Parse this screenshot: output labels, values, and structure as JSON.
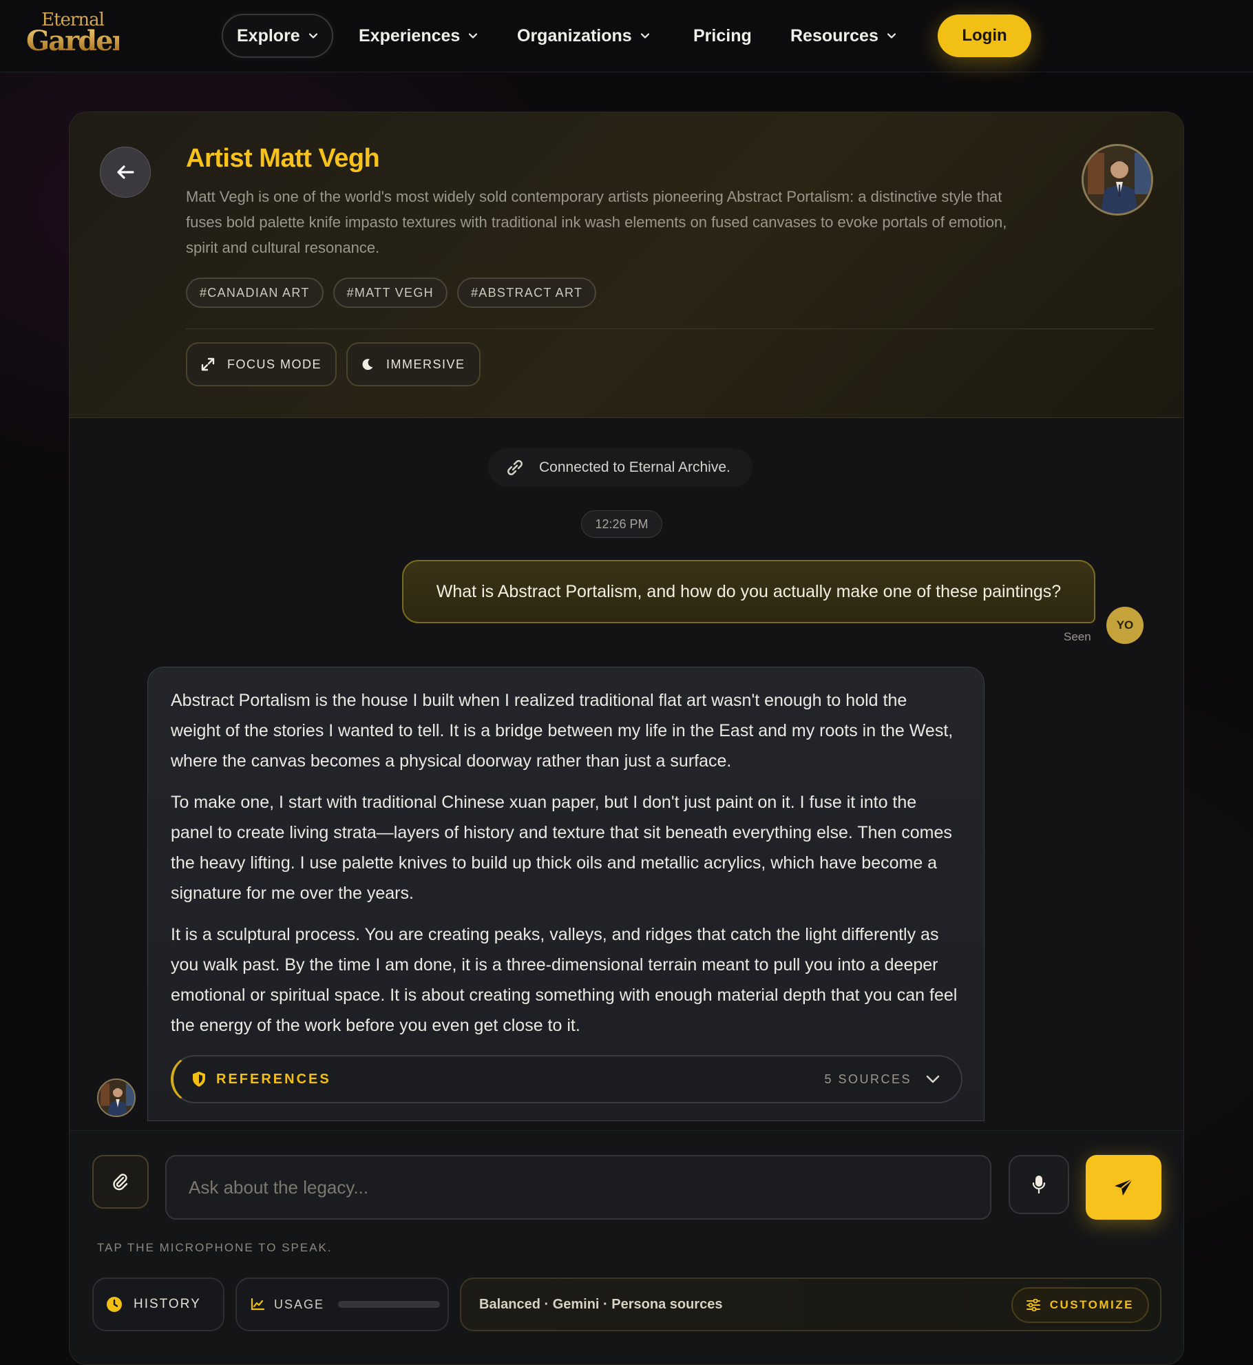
{
  "nav": {
    "logo_line1": "Eternal",
    "logo_line2": "Gardens",
    "items": [
      {
        "label": "Explore"
      },
      {
        "label": "Experiences"
      },
      {
        "label": "Organizations"
      },
      {
        "label": "Pricing"
      },
      {
        "label": "Resources"
      }
    ],
    "login_label": "Login"
  },
  "persona": {
    "title": "Artist Matt Vegh",
    "description": "Matt Vegh is one of the world's most widely sold contemporary artists pioneering Abstract Portalism: a distinctive style that fuses bold palette knife impasto textures with traditional ink wash elements on fused canvases to evoke portals of emotion, spirit and cultural resonance.",
    "tags": [
      "#CANADIAN ART",
      "#MATT VEGH",
      "#ABSTRACT ART"
    ],
    "focus_mode_label": "FOCUS MODE",
    "immersive_label": "IMMERSIVE"
  },
  "chat": {
    "connection_status": "Connected to Eternal Archive.",
    "timestamp": "12:26 PM",
    "user_message": "What is Abstract Portalism, and how do you actually make one of these paintings?",
    "user_initials": "YO",
    "seen_label": "Seen",
    "bot_paragraphs": [
      "Abstract Portalism is the house I built when I realized traditional flat art wasn't enough to hold the weight of the stories I wanted to tell. It is a bridge between my life in the East and my roots in the West, where the canvas becomes a physical doorway rather than just a surface.",
      "To make one, I start with traditional Chinese xuan paper, but I don't just paint on it. I fuse it into the panel to create living strata—layers of history and texture that sit beneath everything else. Then comes the heavy lifting. I use palette knives to build up thick oils and metallic acrylics, which have become a signature for me over the years.",
      "It is a sculptural process. You are creating peaks, valleys, and ridges that catch the light differently as you walk past. By the time I am done, it is a three-dimensional terrain meant to pull you into a deeper emotional or spiritual space. It is about creating something with enough material depth that you can feel the energy of the work before you even get close to it."
    ],
    "references_label": "REFERENCES",
    "sources_count": "5 SOURCES"
  },
  "composer": {
    "placeholder": "Ask about the legacy...",
    "mic_hint": "TAP THE MICROPHONE TO SPEAK.",
    "history_label": "HISTORY",
    "usage_label": "USAGE",
    "usage_fraction": 0,
    "settings_summary": "Balanced · Gemini · Persona sources",
    "customize_label": "CUSTOMIZE"
  },
  "colors": {
    "accent": "#f6c21b",
    "background": "#0b0a0c"
  }
}
